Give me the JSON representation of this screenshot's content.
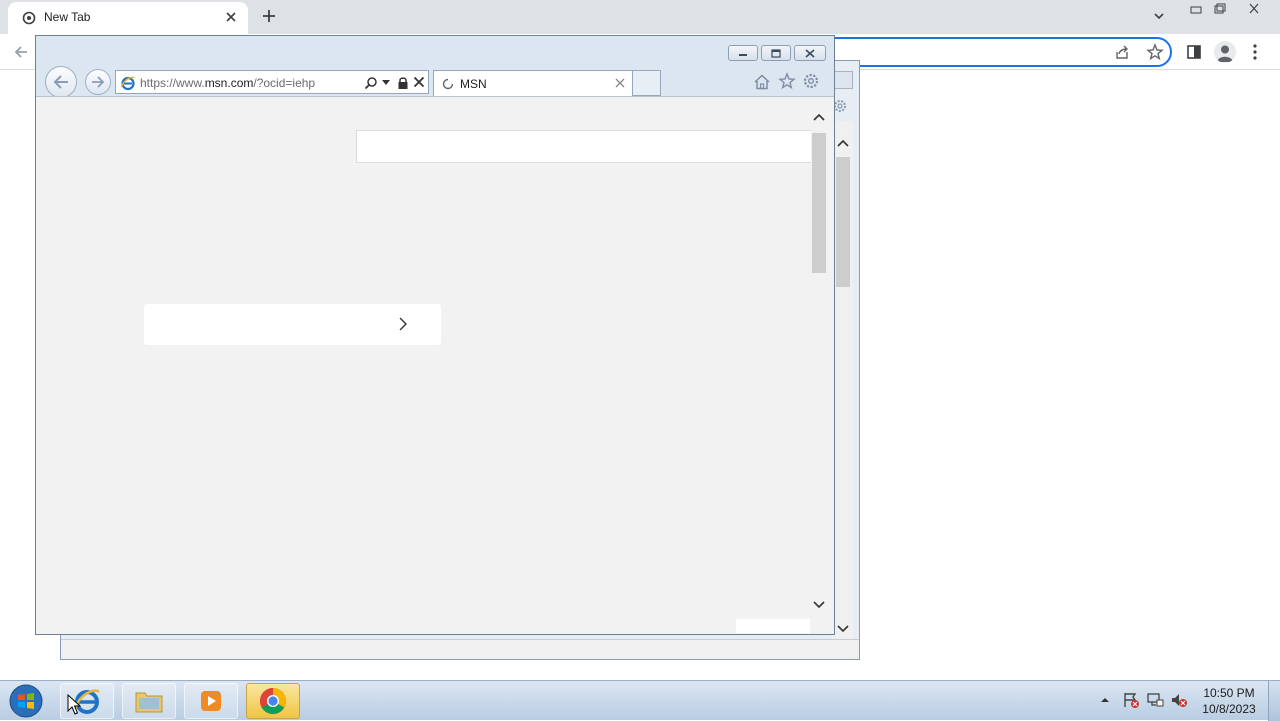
{
  "chrome": {
    "tab_title": "New Tab",
    "icons": [
      "chrome-tab-icon",
      "close-icon",
      "plus-icon",
      "chevron-down-icon",
      "back-icon",
      "share-icon",
      "star-icon",
      "side-panel-icon",
      "profile-icon",
      "more-menu-icon"
    ]
  },
  "ie": {
    "url_proto": "https://www.",
    "url_host": "msn.com",
    "url_rest": "/?ocid=iehp",
    "tab_title": "MSN"
  },
  "taskbar": {
    "time": "10:50 PM",
    "date": "10/8/2023",
    "pinned": [
      "Internet Explorer",
      "Windows Explorer",
      "Windows Media Player",
      "Google Chrome"
    ]
  },
  "colors": {
    "chrome_accent": "#1a73e8",
    "ie_frame": "#dce6f1",
    "content_bg": "#f2f2f2",
    "taskbar": "#c6d6e8"
  }
}
